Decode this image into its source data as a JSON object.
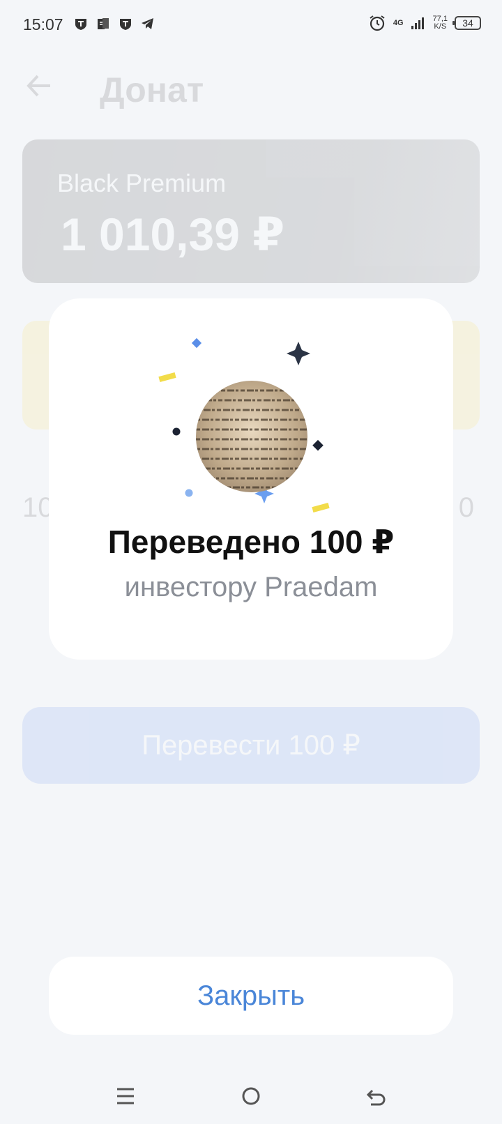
{
  "status_bar": {
    "time": "15:07",
    "network": "4G",
    "speed_value": "77,1",
    "speed_unit": "K/S",
    "battery": "34"
  },
  "background": {
    "page_title": "Донат",
    "card_name": "Black Premium",
    "card_balance": "1 010,39 ₽",
    "amount_left": "10",
    "amount_right": "0",
    "transfer_button_label": "Перевести 100 ₽"
  },
  "modal": {
    "title": "Переведено 100 ₽",
    "subtitle": "инвестору Praedam"
  },
  "close_button_label": "Закрыть",
  "colors": {
    "accent": "#4a86d8",
    "confetti_blue": "#5a8ee8",
    "confetti_yellow": "#f2dc4a",
    "confetti_dark": "#2b3445"
  }
}
